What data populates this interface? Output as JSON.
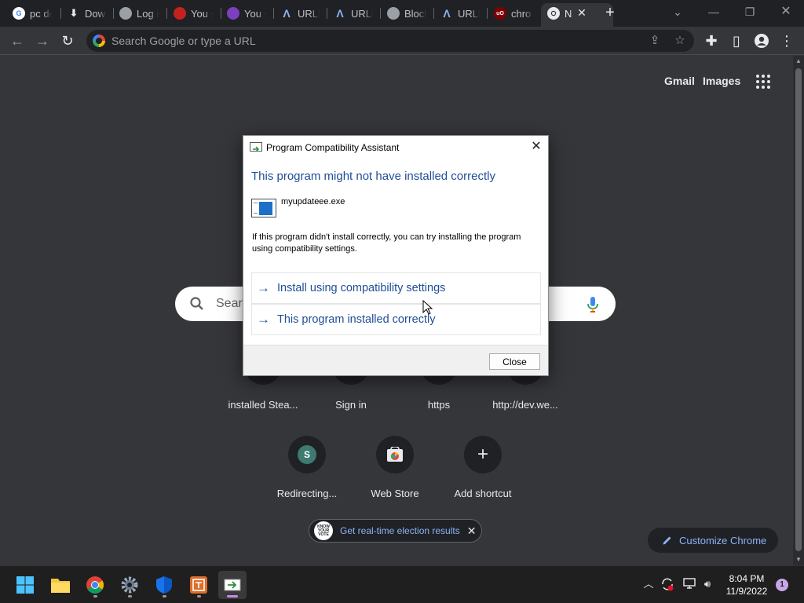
{
  "tabs": [
    {
      "title": "pc de",
      "favicon": "google-icon"
    },
    {
      "title": "Dow",
      "favicon": "download-icon"
    },
    {
      "title": "Log i",
      "favicon": "globe-icon"
    },
    {
      "title": "You s",
      "favicon": "red-shield-icon"
    },
    {
      "title": "You s",
      "favicon": "purple-orb-icon"
    },
    {
      "title": "URLh",
      "favicon": "urlhaus-icon"
    },
    {
      "title": "URLh",
      "favicon": "urlhaus-icon"
    },
    {
      "title": "Block",
      "favicon": "globe-icon"
    },
    {
      "title": "URLh",
      "favicon": "urlhaus-icon"
    },
    {
      "title": "chro",
      "favicon": "ublock-icon"
    },
    {
      "title": "N",
      "favicon": "chrome-icon"
    }
  ],
  "omnibox": {
    "placeholder": "Search Google or type a URL"
  },
  "ntp": {
    "gmail": "Gmail",
    "images": "Images",
    "search_placeholder": "Search Google or type a URL",
    "shortcuts_row1": [
      "installed Stea...",
      "Sign in",
      "https",
      "http://dev.we..."
    ],
    "shortcuts_row2": [
      {
        "label": "Redirecting...",
        "icon": "letter-avatar-icon",
        "letter": "S"
      },
      {
        "label": "Web Store",
        "icon": "web-store-icon"
      },
      {
        "label": "Add shortcut",
        "icon": "plus-icon"
      }
    ],
    "election": {
      "text": "Get real-time election results",
      "badge": "KNOW YOUR VOTE"
    },
    "customize": "Customize Chrome"
  },
  "dialog": {
    "title": "Program Compatibility Assistant",
    "heading": "This program might not have installed correctly",
    "filename": "myupdateee.exe",
    "description": "If this program didn't install correctly, you can try installing the program using compatibility settings.",
    "options": [
      "Install using compatibility settings",
      "This program installed correctly"
    ],
    "close_button": "Close"
  },
  "taskbar": {
    "time": "8:04 PM",
    "date": "11/9/2022",
    "notification_count": "1"
  },
  "colors": {
    "chrome_dark": "#202124",
    "page_bg": "#35363a",
    "dialog_link": "#1f4e96",
    "ntp_link": "#8ab4f8"
  }
}
